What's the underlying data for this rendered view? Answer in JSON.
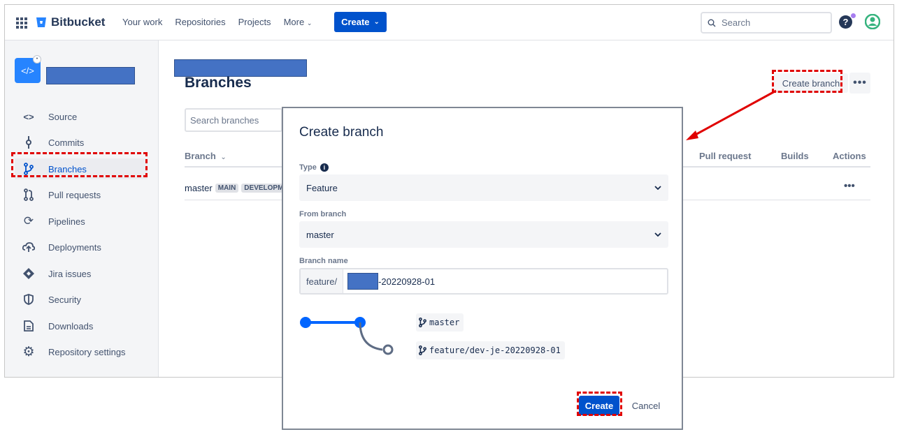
{
  "topnav": {
    "brand": "Bitbucket",
    "links": [
      "Your work",
      "Repositories",
      "Projects",
      "More"
    ],
    "create_label": "Create",
    "search_placeholder": "Search"
  },
  "sidebar": {
    "repo_icon_text": "</>",
    "items": [
      {
        "label": "Source",
        "icon": "code-icon"
      },
      {
        "label": "Commits",
        "icon": "commit-icon"
      },
      {
        "label": "Branches",
        "icon": "branch-icon",
        "active": true
      },
      {
        "label": "Pull requests",
        "icon": "pull-request-icon"
      },
      {
        "label": "Pipelines",
        "icon": "pipelines-icon"
      },
      {
        "label": "Deployments",
        "icon": "cloud-upload-icon"
      },
      {
        "label": "Jira issues",
        "icon": "jira-icon"
      },
      {
        "label": "Security",
        "icon": "shield-icon"
      },
      {
        "label": "Downloads",
        "icon": "document-icon"
      },
      {
        "label": "Repository settings",
        "icon": "gear-icon"
      }
    ]
  },
  "main": {
    "title": "Branches",
    "create_branch_label": "Create branch",
    "more_label": "•••",
    "search_placeholder": "Search branches",
    "columns": {
      "branch": "Branch",
      "pull_request": "Pull request",
      "builds": "Builds",
      "actions": "Actions"
    },
    "rows": [
      {
        "name": "master",
        "lozenges": [
          "MAIN",
          "DEVELOPM"
        ],
        "actions": "•••"
      }
    ]
  },
  "modal": {
    "title": "Create branch",
    "type_label": "Type",
    "type_value": "Feature",
    "from_label": "From branch",
    "from_value": "master",
    "name_label": "Branch name",
    "name_prefix": "feature/",
    "name_suffix": "-20220928-01",
    "diagram": {
      "source": "master",
      "target": "feature/dev-je-20220928-01"
    },
    "create_label": "Create",
    "cancel_label": "Cancel"
  },
  "colors": {
    "accent": "#0052cc",
    "highlight": "#e00000",
    "redaction": "#4472c4"
  }
}
